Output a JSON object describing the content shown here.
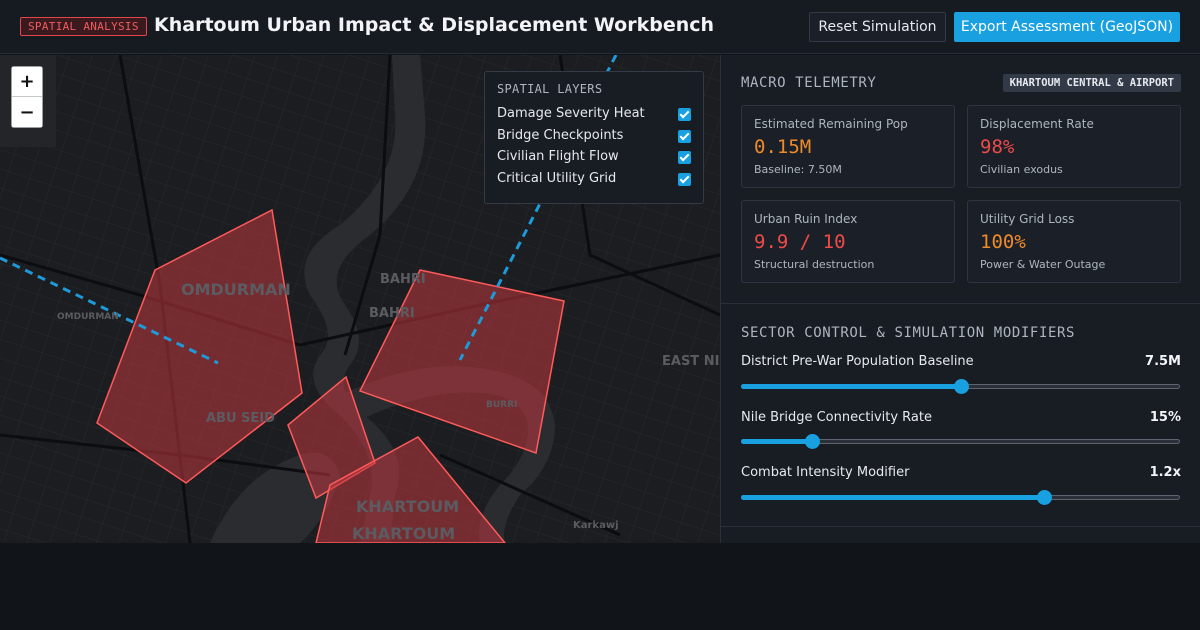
{
  "header": {
    "badge": "SPATIAL ANALYSIS",
    "title": "Khartoum Urban Impact & Displacement Workbench",
    "reset_label": "Reset Simulation",
    "export_label": "Export Assessment (GeoJSON)"
  },
  "map": {
    "zoom_in": "+",
    "zoom_out": "−",
    "place_labels": {
      "omdurman_main": "OMDURMAN",
      "omdurman_small": "OMDURMAN",
      "bahri_a": "BAHRI",
      "bahri_b": "BAHRI",
      "abu_seid": "ABU SEID",
      "burri": "BURRI",
      "east_nil": "EAST NIL",
      "khartoum_a": "KHARTOUM",
      "khartoum_b": "KHARTOUM",
      "karkawj": "Karkawj"
    },
    "layers": {
      "title": "SPATIAL LAYERS",
      "items": [
        {
          "label": "Damage Severity Heat",
          "checked": true
        },
        {
          "label": "Bridge Checkpoints",
          "checked": true
        },
        {
          "label": "Civilian Flight Flow",
          "checked": true
        },
        {
          "label": "Critical Utility Grid",
          "checked": true
        }
      ]
    },
    "colors": {
      "damage_fill": "#c0393f",
      "damage_stroke": "#ff5a5a",
      "flow": "#1e9ad8"
    }
  },
  "telemetry": {
    "title": "MACRO TELEMETRY",
    "location": "KHARTOUM CENTRAL & AIRPORT",
    "cards": [
      {
        "label": "Estimated Remaining Pop",
        "value": "0.15M",
        "sub": "Baseline: 7.50M",
        "color": "orange"
      },
      {
        "label": "Displacement Rate",
        "value": "98%",
        "sub": "Civilian exodus",
        "color": "red"
      },
      {
        "label": "Urban Ruin Index",
        "value": "9.9 / 10",
        "sub": "Structural destruction",
        "color": "red"
      },
      {
        "label": "Utility Grid Loss",
        "value": "100%",
        "sub": "Power & Water Outage",
        "color": "orange"
      }
    ]
  },
  "controls": {
    "title": "SECTOR CONTROL & SIMULATION MODIFIERS",
    "sliders": [
      {
        "label": "District Pre-War Population Baseline",
        "value": "7.5M",
        "fraction": 0.5
      },
      {
        "label": "Nile Bridge Connectivity Rate",
        "value": "15%",
        "fraction": 0.16
      },
      {
        "label": "Combat Intensity Modifier",
        "value": "1.2x",
        "fraction": 0.69
      }
    ]
  }
}
